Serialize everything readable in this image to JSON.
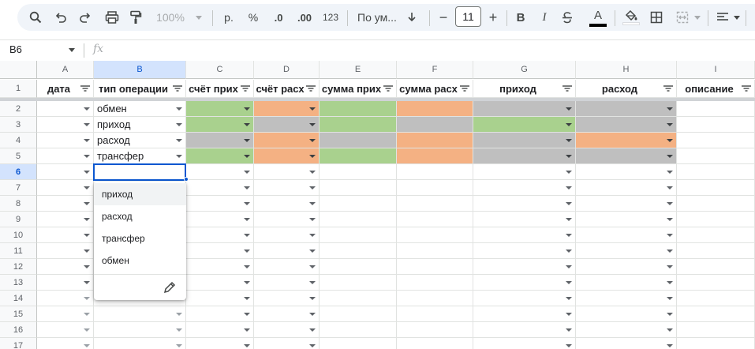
{
  "toolbar": {
    "zoom": "100%",
    "currency": "р.",
    "percent": "%",
    "dec_decrease": ".0",
    "dec_increase": ".00",
    "number_format": "123",
    "font_name": "По ум...",
    "font_size": "11",
    "minus": "−",
    "plus": "+",
    "bold": "B",
    "italic": "I",
    "underline_text_color": "A",
    "text_color": "#000000"
  },
  "formula_bar": {
    "cell_ref": "B6",
    "fx_label": "fx",
    "value": ""
  },
  "columns": [
    "A",
    "B",
    "C",
    "D",
    "E",
    "F",
    "G",
    "H",
    "I"
  ],
  "selected_column": "B",
  "rows": [
    "1",
    "2",
    "3",
    "4",
    "5",
    "6",
    "7",
    "8",
    "9",
    "10",
    "11",
    "12",
    "13",
    "14",
    "15",
    "16",
    "17"
  ],
  "selected_row": "6",
  "header_row": [
    "дата",
    "тип операции",
    "счёт прих",
    "счёт расх",
    "сумма прих",
    "сумма расх",
    "приход",
    "расход",
    "описание"
  ],
  "data_rows": [
    {
      "b": "обмен"
    },
    {
      "b": "приход"
    },
    {
      "b": "расход"
    },
    {
      "b": "трансфер"
    }
  ],
  "colors": {
    "green": "#a9d18e",
    "orange": "#f4b183",
    "gray": "#bfbfbf",
    "accent": "#0b57d0",
    "selected_header": "#d3e3fd"
  },
  "dropdown": {
    "options": [
      "приход",
      "расход",
      "трансфер",
      "обмен"
    ],
    "highlighted": "приход",
    "edit_icon": "pencil-icon"
  }
}
